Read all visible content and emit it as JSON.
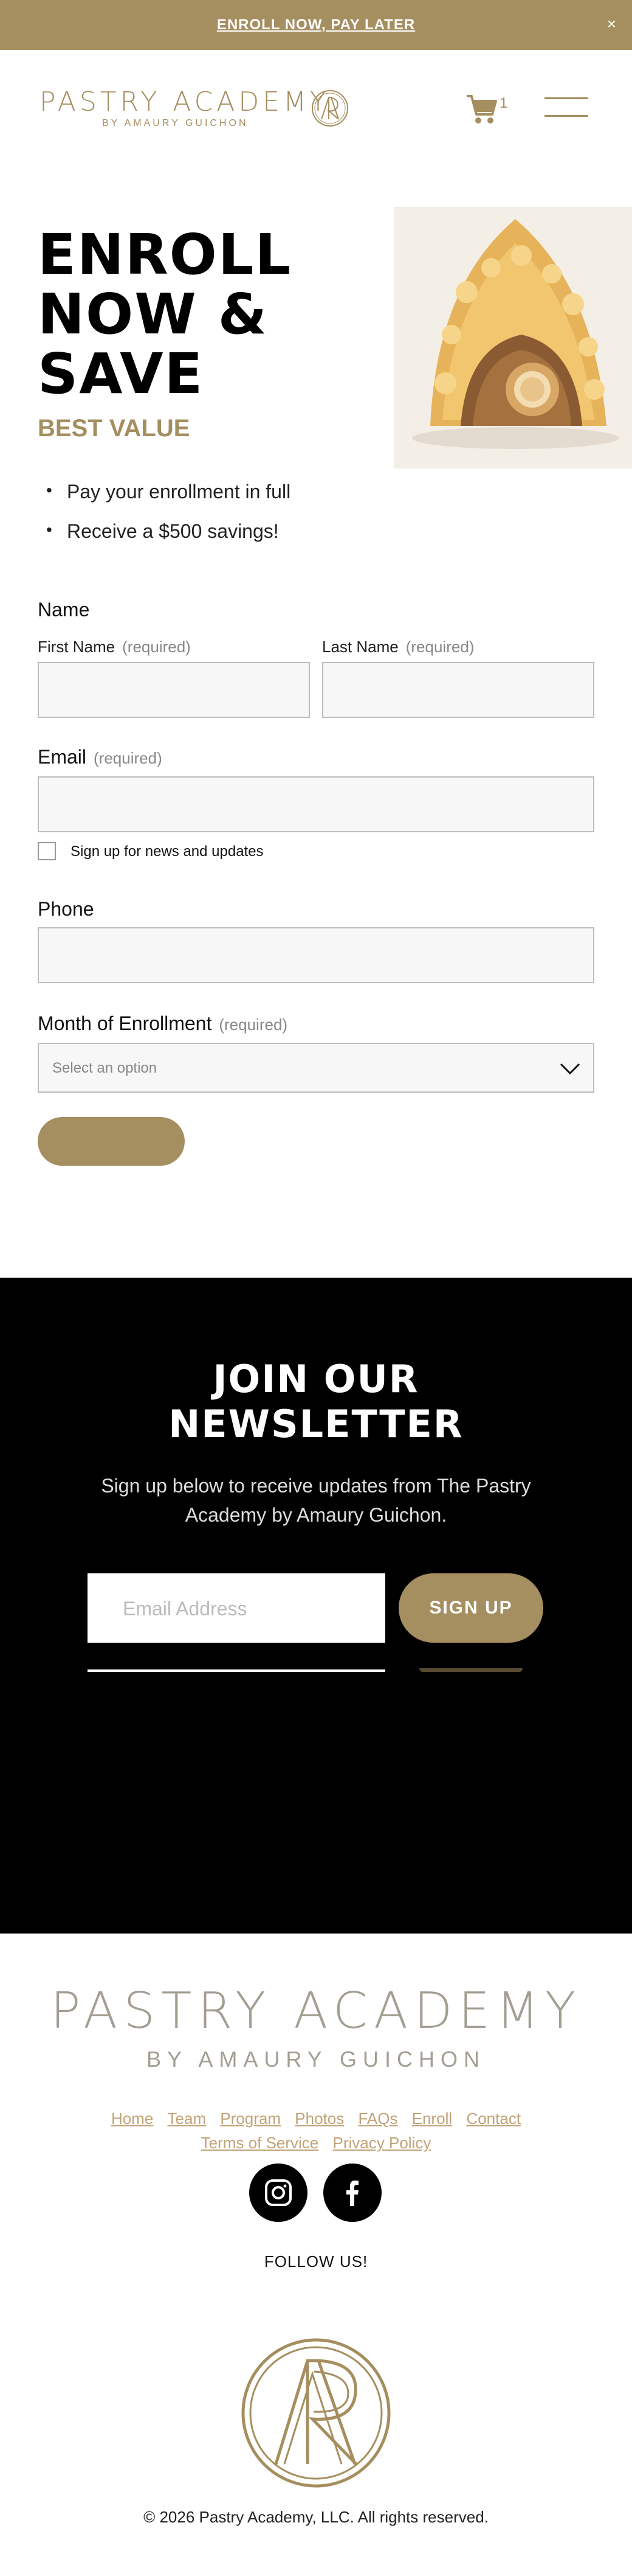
{
  "announcement": {
    "text": "ENROLL NOW, PAY LATER",
    "close": "×"
  },
  "header": {
    "logo_main": "PASTRY ACADEMY",
    "logo_sub": "BY AMAURY GUICHON",
    "cart_count": "1"
  },
  "hero": {
    "title_lines": [
      "ENROLL",
      "NOW &",
      "SAVE"
    ],
    "subtitle": "BEST VALUE",
    "bullets": [
      "Pay your enrollment in full",
      "Receive a $500 savings!"
    ]
  },
  "form": {
    "name_label": "Name",
    "first_name_label": "First Name",
    "last_name_label": "Last Name",
    "email_label": "Email",
    "required": "(required)",
    "signup_label": "Sign up for news and updates",
    "phone_label": "Phone",
    "month_label": "Month of Enrollment",
    "month_placeholder": "Select an option"
  },
  "newsletter": {
    "title_lines": [
      "JOIN OUR",
      "NEWSLETTER"
    ],
    "description": "Sign up below to receive updates from The Pastry Academy by Amaury Guichon.",
    "email_placeholder": "Email Address",
    "button": "SIGN UP"
  },
  "footer": {
    "logo_main": "PASTRY ACADEMY",
    "logo_sub": "BY AMAURY GUICHON",
    "links_row1": [
      "Home",
      "Team",
      "Program",
      "Photos",
      "FAQs",
      "Enroll",
      "Contact"
    ],
    "links_row2": [
      "Terms of Service",
      "Privacy Policy"
    ],
    "follow": "FOLLOW US!",
    "copyright": "© 2026 Pastry Academy, LLC. All rights reserved."
  },
  "colors": {
    "gold": "#a58e5f",
    "black": "#000000",
    "footer_gray": "#a39d92",
    "link_gold": "#c2a276"
  },
  "icons": [
    "close-icon",
    "ap-monogram-icon",
    "cart-icon",
    "hamburger-icon",
    "chevron-down-icon",
    "instagram-icon",
    "facebook-icon"
  ]
}
